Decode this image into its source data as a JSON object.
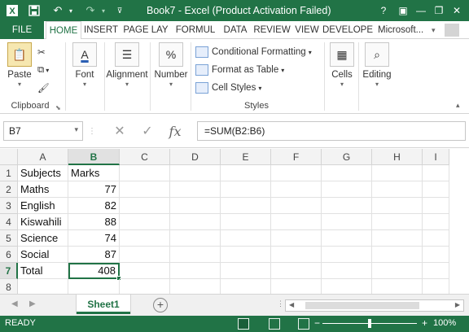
{
  "window": {
    "title": "Book7 - Excel (Product Activation Failed)",
    "help_label": "?",
    "minimize_label": "—",
    "restore_label": "❐",
    "close_label": "✕"
  },
  "quick_access": {
    "save_icon": "save-icon",
    "undo_icon": "undo-icon",
    "redo_icon": "redo-icon",
    "customize_icon": "customize-icon"
  },
  "tabs": [
    {
      "label": "FILE"
    },
    {
      "label": "HOME"
    },
    {
      "label": "INSERT"
    },
    {
      "label": "PAGE LAY"
    },
    {
      "label": "FORMUL"
    },
    {
      "label": "DATA"
    },
    {
      "label": "REVIEW"
    },
    {
      "label": "VIEW"
    },
    {
      "label": "DEVELOPE"
    }
  ],
  "account": {
    "label": "Microsoft..."
  },
  "ribbon": {
    "clipboard": {
      "paste_label": "Paste",
      "group_label": "Clipboard"
    },
    "font": {
      "label": "Font"
    },
    "alignment": {
      "label": "Alignment"
    },
    "number": {
      "label": "Number"
    },
    "styles": {
      "conditional_label": "Conditional Formatting",
      "format_table_label": "Format as Table",
      "cell_styles_label": "Cell Styles",
      "group_label": "Styles"
    },
    "cells": {
      "label": "Cells"
    },
    "editing": {
      "label": "Editing"
    }
  },
  "formula_bar": {
    "name_box": "B7",
    "formula": "=SUM(B2:B6)"
  },
  "sheet": {
    "columns": [
      "A",
      "B",
      "C",
      "D",
      "E",
      "F",
      "G",
      "H",
      "I"
    ],
    "rows": [
      "1",
      "2",
      "3",
      "4",
      "5",
      "6",
      "7",
      "8"
    ],
    "cells": [
      [
        "Subjects",
        "Marks"
      ],
      [
        "Maths",
        "77"
      ],
      [
        "English",
        "82"
      ],
      [
        "Kiswahili",
        "88"
      ],
      [
        "Science",
        "74"
      ],
      [
        "Social",
        "87"
      ],
      [
        "Total",
        "408"
      ],
      [
        "",
        ""
      ]
    ],
    "active_cell": "B7",
    "tab_label": "Sheet1"
  },
  "status_bar": {
    "ready": "READY",
    "zoom": "100%",
    "zoom_out": "−",
    "zoom_in": "+"
  }
}
